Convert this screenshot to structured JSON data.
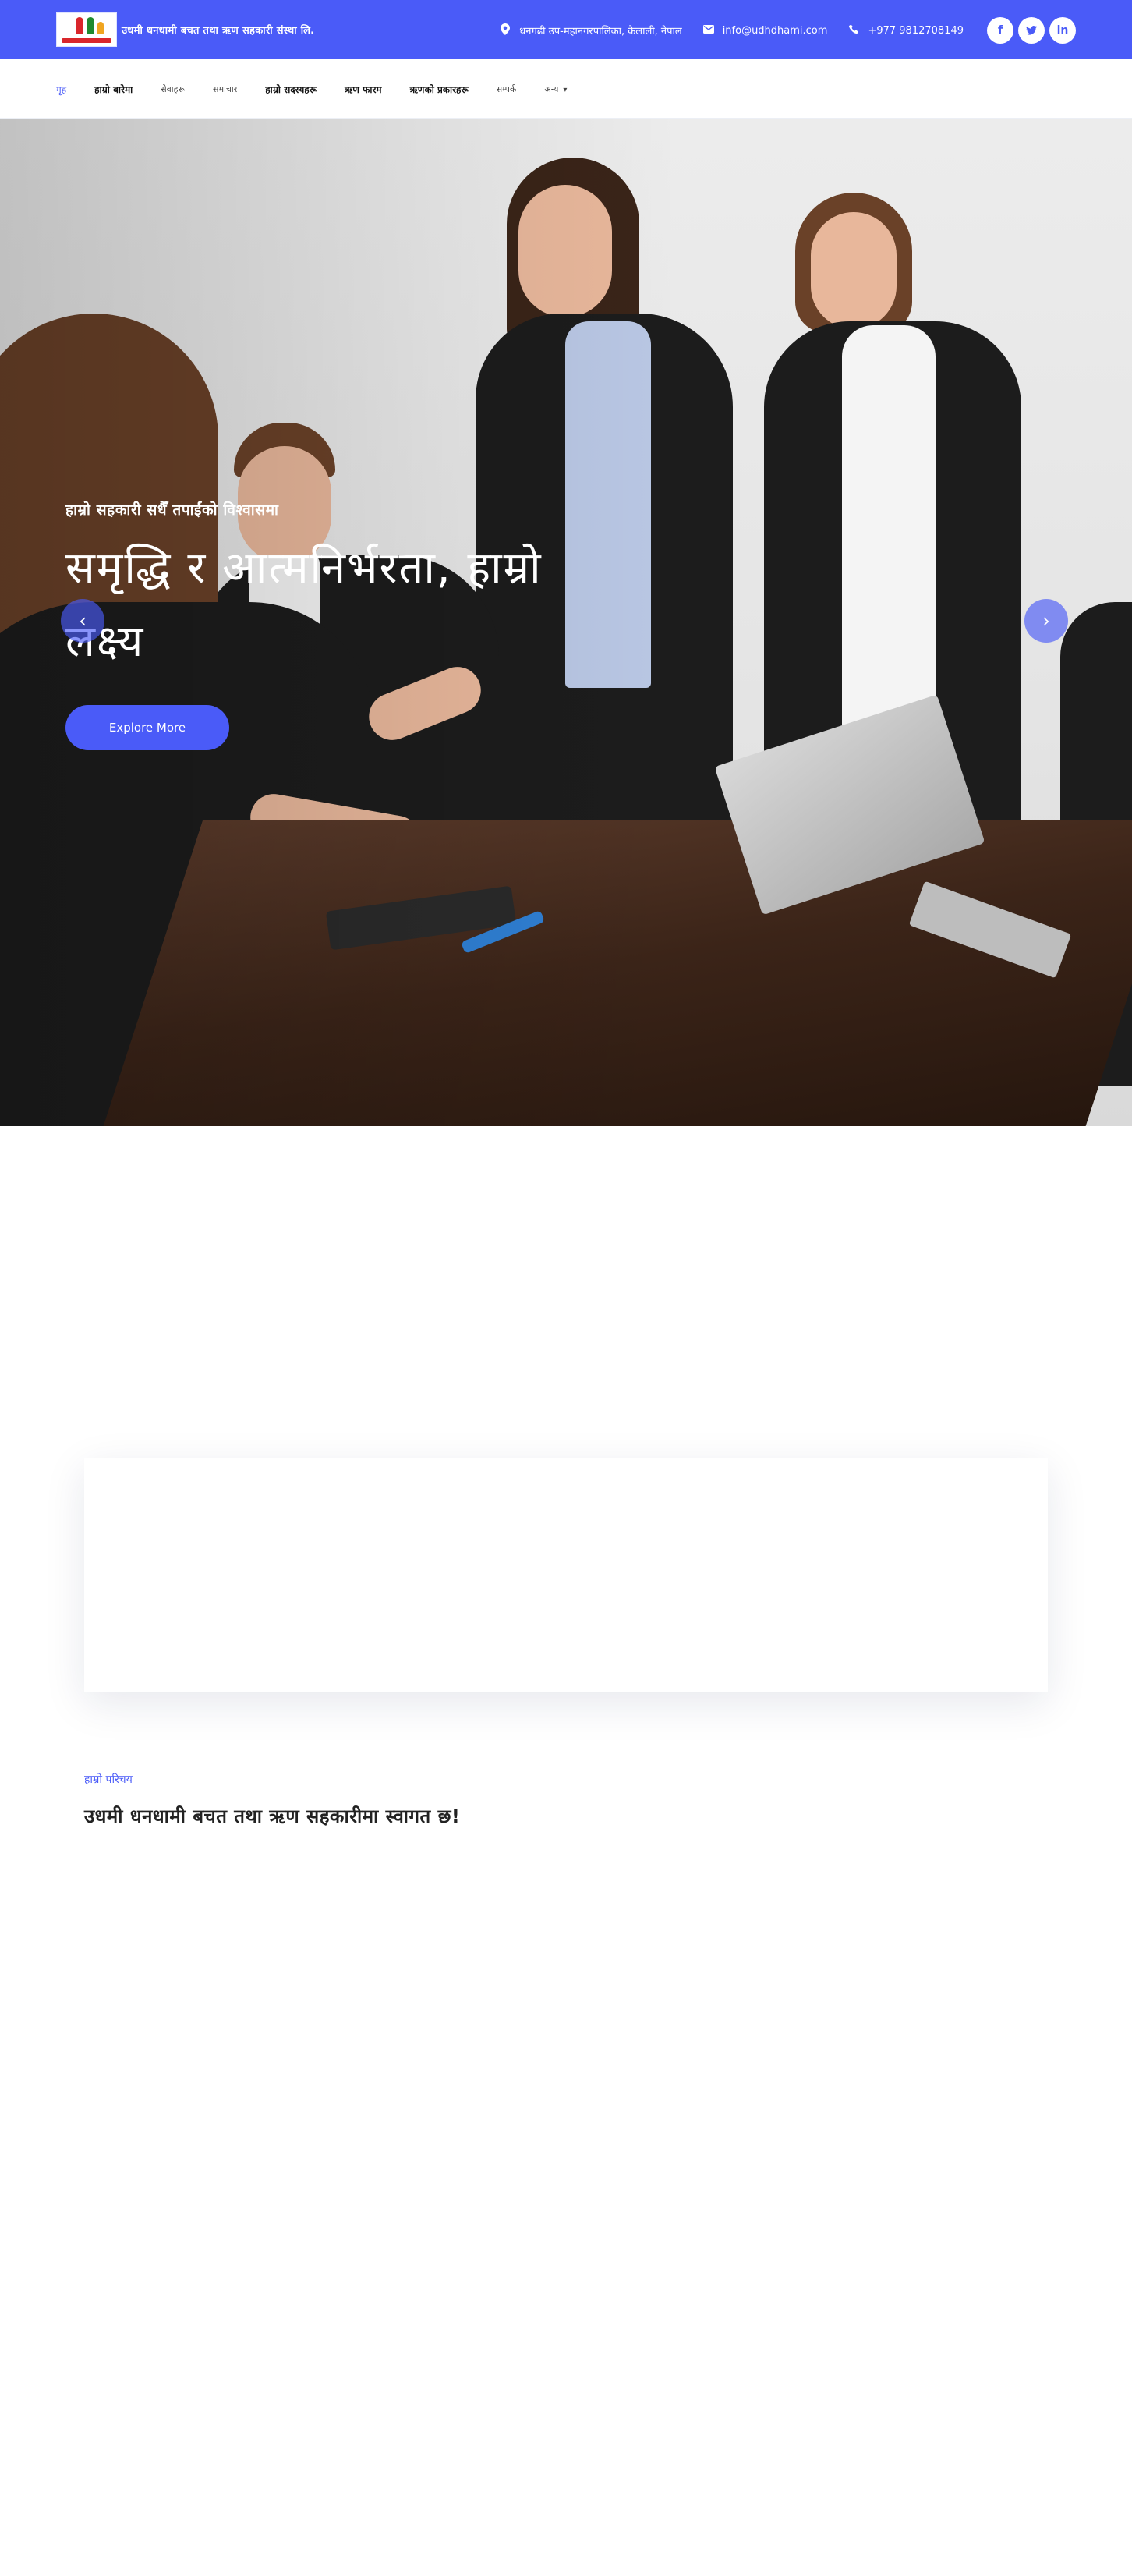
{
  "header": {
    "brand_name": "उधमी धनधामी बचत तथा ऋण सहकारी संस्था लि.",
    "address": "धनगढी उप-महानगरपालिका, कैलाली, नेपाल",
    "email": "info@udhdhami.com",
    "phone": "+977 9812708149",
    "socials": [
      {
        "name": "facebook",
        "glyph": "f"
      },
      {
        "name": "twitter",
        "glyph": "t"
      },
      {
        "name": "linkedin",
        "glyph": "in"
      }
    ]
  },
  "nav": {
    "items": [
      {
        "label": "गृह"
      },
      {
        "label": "हाम्रो बारेमा"
      },
      {
        "label": "सेवाहरू"
      },
      {
        "label": "समाचार"
      },
      {
        "label": "हाम्रो सदस्यहरू"
      },
      {
        "label": "ऋण फारम"
      },
      {
        "label": "ऋणको प्रकारहरू"
      },
      {
        "label": "सम्पर्क"
      },
      {
        "label": "अन्य"
      }
    ]
  },
  "hero": {
    "kicker": "हाम्रो सहकारी सधैँ तपाईंको विश्वासमा",
    "title": "समृद्धि र आत्मनिर्भरता, हाम्रो लक्ष्य",
    "button": "Explore More",
    "prev": "‹",
    "next": "›"
  },
  "section": {
    "kicker": "हाम्रो परिचय",
    "title": "उधमी धनधामी बचत तथा ऋण सहकारीमा स्वागत छ!"
  },
  "colors": {
    "brand": "#4a5bf8",
    "white": "#ffffff"
  }
}
